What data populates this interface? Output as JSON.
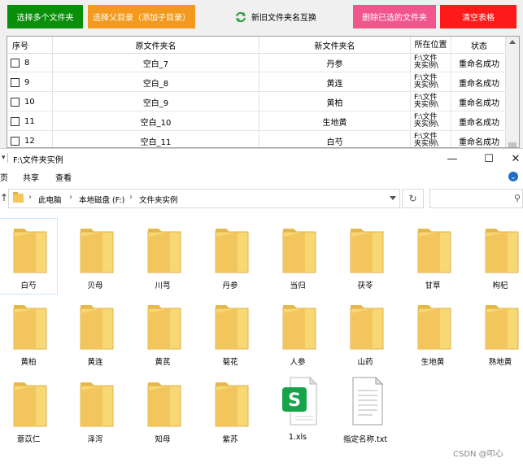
{
  "app": {
    "buttons": [
      {
        "label": "选择多个文件夹",
        "color": "#0a8f0a"
      },
      {
        "label": "选择父目录（添加子目录）",
        "color": "#f39a1e"
      },
      {
        "label": "新旧文件夹名互换",
        "color": ""
      },
      {
        "label": "删除已选的文件夹",
        "color": "#f0558c"
      },
      {
        "label": "清空表格",
        "color": "#ff1a1a"
      }
    ],
    "table": {
      "headers": [
        "序号",
        "原文件夹名",
        "新文件夹名",
        "所在位置",
        "状态"
      ],
      "rows": [
        {
          "no": "8",
          "old": "空白_7",
          "new": "丹参",
          "loc": "F:\\文件\n夹实例\\",
          "status": "重命名成功"
        },
        {
          "no": "9",
          "old": "空白_8",
          "new": "黄连",
          "loc": "F:\\文件\n夹实例\\",
          "status": "重命名成功"
        },
        {
          "no": "10",
          "old": "空白_9",
          "new": "黄柏",
          "loc": "F:\\文件\n夹实例\\",
          "status": "重命名成功"
        },
        {
          "no": "11",
          "old": "空白_10",
          "new": "生地黄",
          "loc": "F:\\文件\n夹实例\\",
          "status": "重命名成功"
        },
        {
          "no": "12",
          "old": "空白_11",
          "new": "白芍",
          "loc": "F:\\文件\n夹实例\\",
          "status": "重命名成功"
        }
      ]
    }
  },
  "explorer": {
    "title": "F:\\文件夹实例",
    "ribbon_tabs": [
      "页",
      "共享",
      "查看"
    ],
    "breadcrumbs": [
      "此电脑",
      "本地磁盘 (F:)",
      "文件夹实例"
    ],
    "search_placeholder": "",
    "items": [
      {
        "name": "白芍",
        "type": "folder"
      },
      {
        "name": "贝母",
        "type": "folder"
      },
      {
        "name": "川芎",
        "type": "folder"
      },
      {
        "name": "丹参",
        "type": "folder"
      },
      {
        "name": "当归",
        "type": "folder"
      },
      {
        "name": "茯苓",
        "type": "folder"
      },
      {
        "name": "甘草",
        "type": "folder"
      },
      {
        "name": "枸杞",
        "type": "folder"
      },
      {
        "name": "黄柏",
        "type": "folder"
      },
      {
        "name": "黄连",
        "type": "folder"
      },
      {
        "name": "黄芪",
        "type": "folder"
      },
      {
        "name": "菊花",
        "type": "folder"
      },
      {
        "name": "人参",
        "type": "folder"
      },
      {
        "name": "山药",
        "type": "folder"
      },
      {
        "name": "生地黄",
        "type": "folder"
      },
      {
        "name": "熟地黄",
        "type": "folder"
      },
      {
        "name": "薏苡仁",
        "type": "folder"
      },
      {
        "name": "泽泻",
        "type": "folder"
      },
      {
        "name": "知母",
        "type": "folder"
      },
      {
        "name": "紫苏",
        "type": "folder"
      },
      {
        "name": "1.xls",
        "type": "xls"
      },
      {
        "name": "指定名称.txt",
        "type": "txt"
      }
    ]
  },
  "watermark": "CSDN @叩心"
}
